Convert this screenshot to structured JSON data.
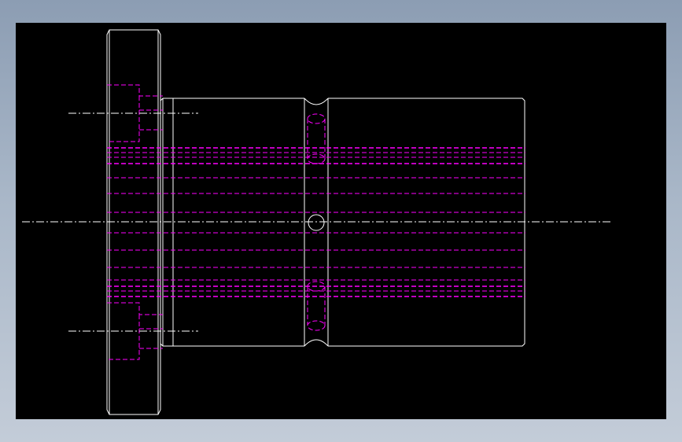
{
  "drawing": {
    "background": "#000000",
    "colors": {
      "outline": "#ffffff",
      "hidden": "#ff00ff",
      "centerline": "#ffffff"
    },
    "features": [
      "flange",
      "main-body",
      "groove",
      "cross-hole",
      "bolt-holes",
      "centerlines"
    ]
  }
}
